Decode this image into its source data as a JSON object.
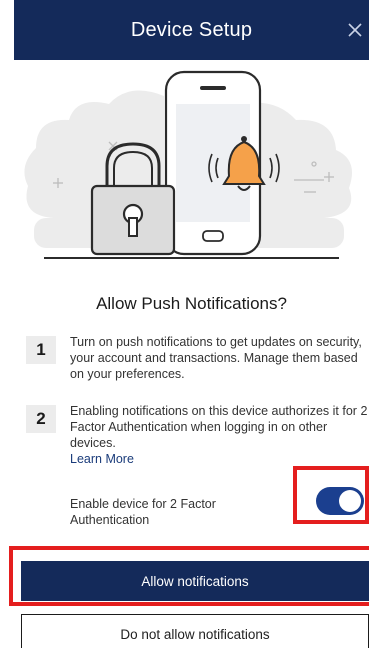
{
  "header": {
    "title": "Device Setup",
    "close_icon": "close-icon",
    "background_color": "#142a5a"
  },
  "illustration": {
    "description_icons": [
      "phone-icon",
      "bell-icon",
      "padlock-icon",
      "cloud-icon"
    ]
  },
  "main": {
    "heading": "Allow Push Notifications?",
    "steps": [
      {
        "number": "1",
        "text": "Turn on push notifications to get updates on security, your account and transactions. Manage them based on your preferences."
      },
      {
        "number": "2",
        "text": "Enabling notifications on this device authorizes it for 2 Factor Authentication when logging in on other devices.",
        "link": "Learn More"
      }
    ],
    "twofa": {
      "label": "Enable device for 2 Factor Authentication",
      "enabled": true
    }
  },
  "buttons": {
    "allow": "Allow notifications",
    "deny": "Do not allow notifications"
  },
  "colors": {
    "brand_navy": "#142a5a",
    "toggle_on": "#1b3f8f",
    "highlight": "#e41e1e",
    "bell": "#f5a14a"
  }
}
